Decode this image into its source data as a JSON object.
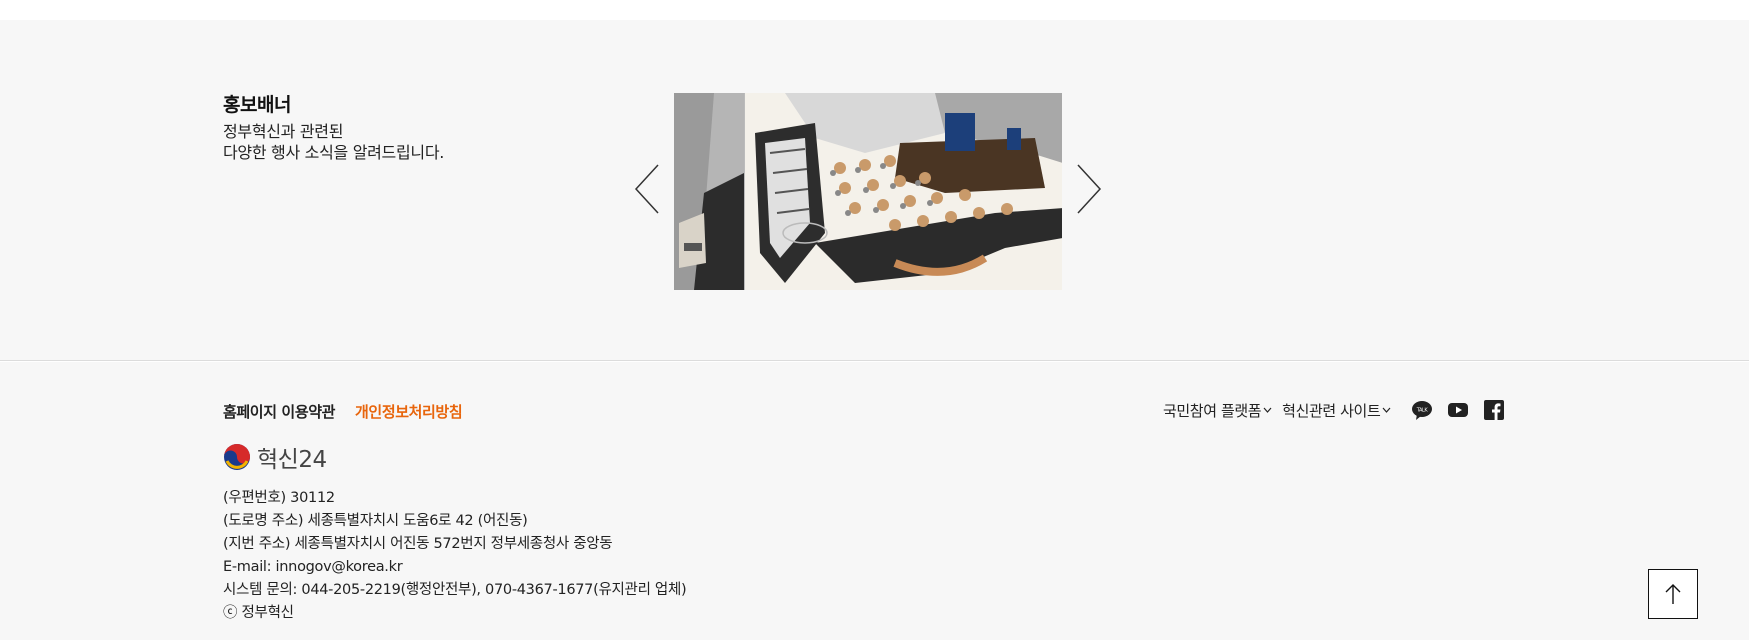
{
  "banner": {
    "title": "홍보배너",
    "desc_line1": "정부혁신과 관련된",
    "desc_line2": "다양한 행사 소식을 알려드립니다."
  },
  "slider": {
    "prev_icon": "chevron-left-icon",
    "next_icon": "chevron-right-icon"
  },
  "footer": {
    "terms_label": "홈페이지 이용약관",
    "privacy_label": "개인정보처리방침",
    "privacy_color": "#e8650c",
    "platform_label": "국민참여 플랫폼",
    "innovation_sites_label": "혁신관련 사이트",
    "social": [
      "kakao-talk-icon",
      "youtube-icon",
      "facebook-icon"
    ],
    "logo_text": "혁신24",
    "address": [
      "(우편번호) 30112",
      "(도로명 주소) 세종특별자치시 도움6로 42 (어진동)",
      "(지번 주소) 세종특별자치시 어진동 572번지 정부세종청사 중앙동",
      "E-mail: innogov@korea.kr",
      "시스템 문의: 044-205-2219(행정안전부), 070-4367-1677(유지관리 업체)",
      "ⓒ 정부혁신"
    ]
  },
  "top_button_icon": "arrow-up-icon"
}
